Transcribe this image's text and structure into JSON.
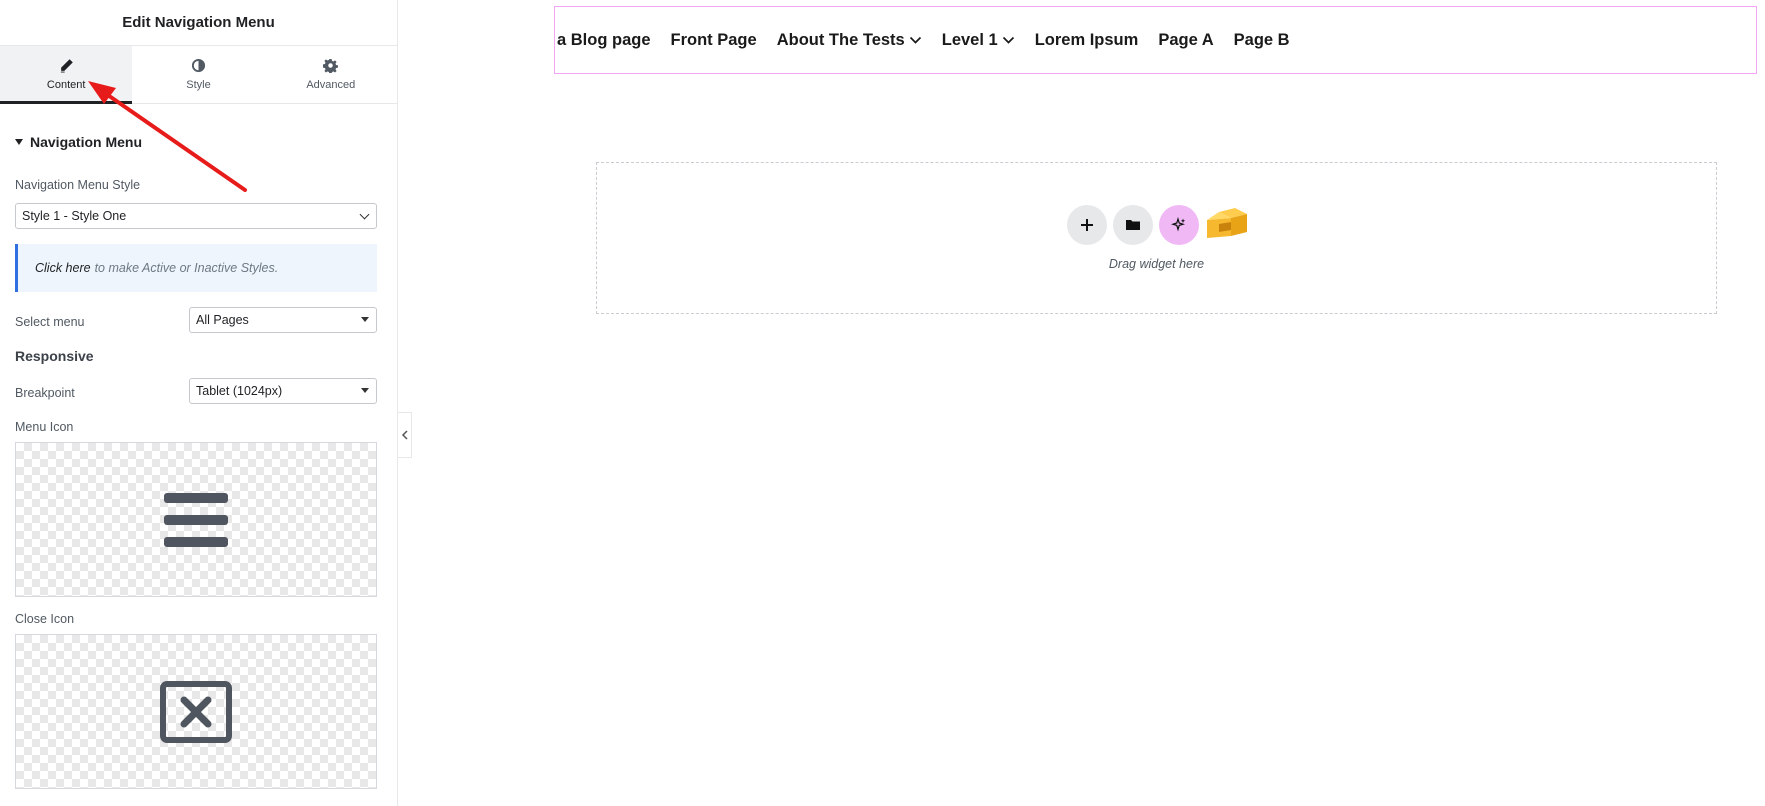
{
  "panel": {
    "title": "Edit Navigation Menu",
    "tabs": [
      {
        "label": "Content",
        "icon": "pencil-icon",
        "active": true
      },
      {
        "label": "Style",
        "icon": "half-circle-icon",
        "active": false
      },
      {
        "label": "Advanced",
        "icon": "gear-icon",
        "active": false
      }
    ],
    "section": {
      "title": "Navigation Menu"
    },
    "menu_style": {
      "label": "Navigation Menu Style",
      "value": "Style 1 - Style One"
    },
    "notice": {
      "link": "Click here",
      "text": "to make Active or Inactive Styles."
    },
    "select_menu": {
      "label": "Select menu",
      "value": "All Pages"
    },
    "responsive_title": "Responsive",
    "breakpoint": {
      "label": "Breakpoint",
      "value": "Tablet (1024px)"
    },
    "menu_icon": {
      "label": "Menu Icon",
      "icon": "hamburger-icon"
    },
    "close_icon": {
      "label": "Close Icon",
      "icon": "close-box-icon"
    }
  },
  "canvas": {
    "nav_items": [
      {
        "label": "a Blog page",
        "has_dropdown": false
      },
      {
        "label": "Front Page",
        "has_dropdown": false
      },
      {
        "label": "About The Tests",
        "has_dropdown": true
      },
      {
        "label": "Level 1",
        "has_dropdown": true
      },
      {
        "label": "Lorem Ipsum",
        "has_dropdown": false
      },
      {
        "label": "Page A",
        "has_dropdown": false
      },
      {
        "label": "Page B",
        "has_dropdown": false
      }
    ],
    "drop_zone": {
      "text": "Drag widget here",
      "buttons": [
        "add-icon",
        "folder-icon",
        "ai-sparkle-icon",
        "template-library-icon"
      ]
    }
  },
  "colors": {
    "accent_arrow": "#e81b1b",
    "nav_outline": "#f0a6f4",
    "ai_button": "#f0b8f5",
    "notice_border": "#2f6fdf"
  }
}
